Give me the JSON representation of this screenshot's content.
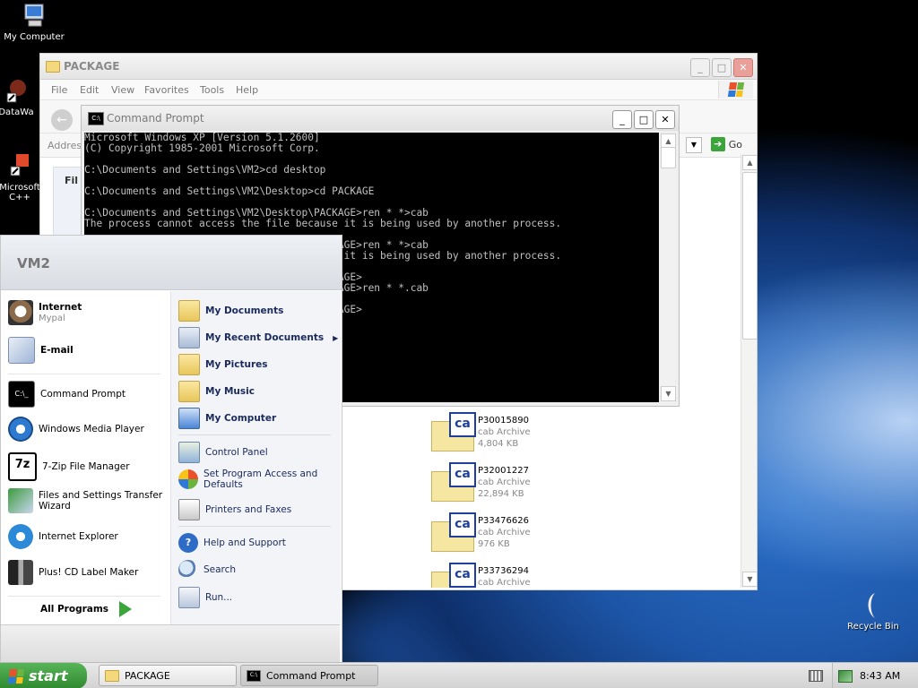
{
  "desktop": {
    "icons": [
      {
        "label": "My Computer"
      },
      {
        "label": "DataWa"
      },
      {
        "label": "Microsoft C++"
      },
      {
        "label": "Recycle Bin"
      }
    ]
  },
  "explorer": {
    "title": "PACKAGE",
    "menu": [
      "File",
      "Edit",
      "View",
      "Favorites",
      "Tools",
      "Help"
    ],
    "address_label": "Addres",
    "go_label": "Go",
    "files": [
      {
        "name": "P30015890",
        "type": "cab Archive",
        "size": "4,804 KB"
      },
      {
        "name": "P32001227",
        "type": "cab Archive",
        "size": "22,894 KB"
      },
      {
        "name": "P33476626",
        "type": "cab Archive",
        "size": "976 KB"
      },
      {
        "name": "P33736294",
        "type": "cab Archive",
        "size": ""
      }
    ],
    "cab_icon_text": "ca"
  },
  "cmd": {
    "title": "Command Prompt",
    "lines": [
      "Microsoft Windows XP [Version 5.1.2600]",
      "(C) Copyright 1985-2001 Microsoft Corp.",
      "",
      "C:\\Documents and Settings\\VM2>cd desktop",
      "",
      "C:\\Documents and Settings\\VM2\\Desktop>cd PACKAGE",
      "",
      "C:\\Documents and Settings\\VM2\\Desktop\\PACKAGE>ren * *>cab",
      "The process cannot access the file because it is being used by another process.",
      "",
      "C:\\Documents and Settings\\VM2\\Desktop\\PACKAGE>ren * *>cab",
      "The process cannot access the file because it is being used by another process.",
      "",
      "C:\\Documents and Settings\\VM2\\Desktop\\PACKAGE>",
      "C:\\Documents and Settings\\VM2\\Desktop\\PACKAGE>ren * *.cab",
      "",
      "C:\\Documents and Settings\\VM2\\Desktop\\PACKAGE>"
    ]
  },
  "startmenu": {
    "user": "VM2",
    "pinned": [
      {
        "title": "Internet",
        "subtitle": "Mypal",
        "icon": "internet-icon"
      },
      {
        "title": "E-mail",
        "subtitle": "",
        "icon": "email-icon"
      }
    ],
    "recent": [
      {
        "title": "Command Prompt",
        "icon": "command-prompt-icon"
      },
      {
        "title": "Windows Media Player",
        "icon": "media-player-icon"
      },
      {
        "title": "7-Zip File Manager",
        "icon": "7zip-icon"
      },
      {
        "title": "Files and Settings Transfer Wizard",
        "icon": "transfer-wizard-icon"
      },
      {
        "title": "Internet Explorer",
        "icon": "internet-explorer-icon"
      },
      {
        "title": "Plus! CD Label Maker",
        "icon": "cd-label-icon"
      }
    ],
    "all_programs": "All Programs",
    "right_top": [
      {
        "title": "My Documents"
      },
      {
        "title": "My Recent Documents"
      },
      {
        "title": "My Pictures"
      },
      {
        "title": "My Music"
      },
      {
        "title": "My Computer"
      }
    ],
    "right_mid": [
      {
        "title": "Control Panel"
      },
      {
        "title": "Set Program Access and Defaults"
      },
      {
        "title": "Printers and Faxes"
      }
    ],
    "right_bottom": [
      {
        "title": "Help and Support"
      },
      {
        "title": "Search"
      },
      {
        "title": "Run..."
      }
    ]
  },
  "taskbar": {
    "start_label": "start",
    "tasks": [
      {
        "label": "PACKAGE"
      },
      {
        "label": "Command Prompt"
      }
    ],
    "clock": "8:43 AM"
  }
}
